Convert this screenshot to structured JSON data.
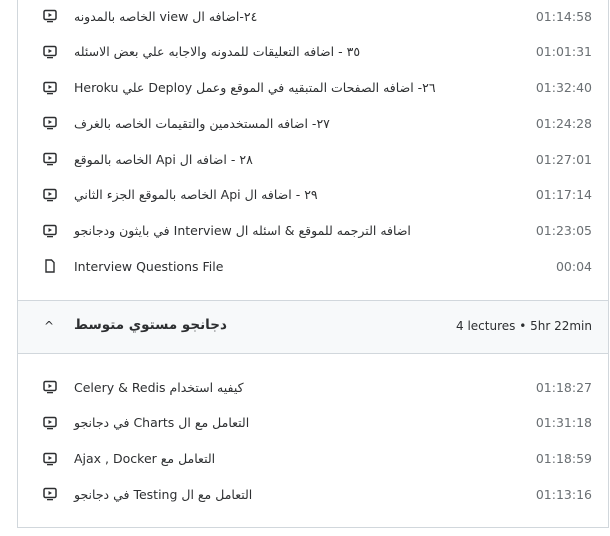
{
  "section1": {
    "items": [
      {
        "type": "video",
        "title": "٢٤-اضافه ال view الخاصه بالمدونه",
        "duration": "01:14:58"
      },
      {
        "type": "video",
        "title": "٣٥ - اضافه التعليقات للمدونه والاجابه علي بعض الاسئله",
        "duration": "01:01:31"
      },
      {
        "type": "video",
        "title": "٢٦- اضافه الصفحات المتبقيه في الموقع وعمل Deploy علي Heroku",
        "duration": "01:32:40"
      },
      {
        "type": "video",
        "title": "٢٧- اضافه المستخدمين والتقيمات الخاصه بالغرف",
        "duration": "01:24:28"
      },
      {
        "type": "video",
        "title": "٢٨ - اضافه ال Api الخاصه بالموقع",
        "duration": "01:27:01"
      },
      {
        "type": "video",
        "title": "٢٩ - اضافه ال Api الخاصه بالموقع الجزء الثاني",
        "duration": "01:17:14"
      },
      {
        "type": "video",
        "title": "اضافه الترجمه للموقع & اسئله ال Interview في بايثون ودجانجو",
        "duration": "01:23:05"
      },
      {
        "type": "file",
        "title": "Interview Questions File",
        "duration": "00:04"
      }
    ]
  },
  "section2": {
    "title": "دجانجو مستوي متوسط",
    "meta": "4 lectures • 5hr 22min",
    "items": [
      {
        "type": "video",
        "title": "كيفيه استخدام Celery & Redis",
        "duration": "01:18:27"
      },
      {
        "type": "video",
        "title": "التعامل مع ال Charts في دجانجو",
        "duration": "01:31:18"
      },
      {
        "type": "video",
        "title": "التعامل مع Ajax , Docker",
        "duration": "01:18:59"
      },
      {
        "type": "video",
        "title": "التعامل مع ال Testing في دجانجو",
        "duration": "01:13:16"
      }
    ]
  }
}
